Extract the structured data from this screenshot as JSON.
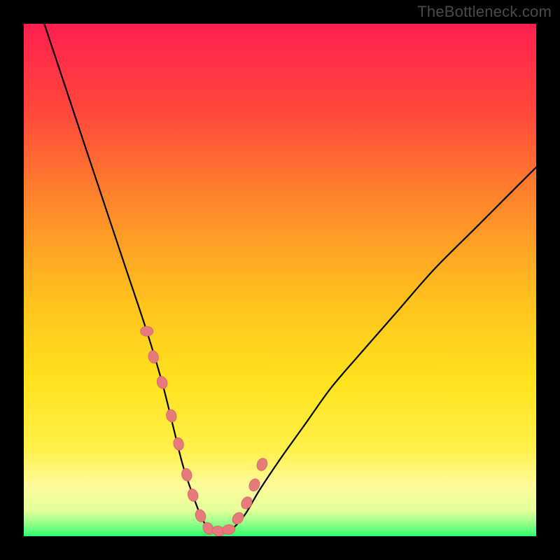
{
  "watermark": "TheBottleneck.com",
  "colors": {
    "frame": "#000000",
    "curve": "#000000",
    "dots_fill": "#e77a7a",
    "dots_stroke": "#d66a6a",
    "gradient_stops": [
      {
        "offset": 0.0,
        "color": "#ff1f4f"
      },
      {
        "offset": 0.18,
        "color": "#ff4a3a"
      },
      {
        "offset": 0.36,
        "color": "#ff8b2a"
      },
      {
        "offset": 0.54,
        "color": "#ffc21e"
      },
      {
        "offset": 0.7,
        "color": "#ffe31e"
      },
      {
        "offset": 0.83,
        "color": "#fff04a"
      },
      {
        "offset": 0.9,
        "color": "#fffa9a"
      },
      {
        "offset": 0.95,
        "color": "#e4ff9a"
      },
      {
        "offset": 0.975,
        "color": "#95ff8a"
      },
      {
        "offset": 1.0,
        "color": "#2bff6a"
      }
    ]
  },
  "chart_data": {
    "type": "line",
    "title": "",
    "xlabel": "",
    "ylabel": "",
    "xlim": [
      0,
      100
    ],
    "ylim": [
      0,
      100
    ],
    "grid": false,
    "series": [
      {
        "name": "bottleneck-curve",
        "x": [
          4,
          8,
          12,
          16,
          20,
          24,
          27,
          29,
          31,
          33,
          35,
          37,
          40,
          43,
          46,
          50,
          55,
          60,
          66,
          73,
          80,
          88,
          96,
          100
        ],
        "y": [
          100,
          88,
          76,
          64,
          52,
          40,
          30,
          22,
          14,
          8,
          3,
          1,
          1,
          4,
          9,
          15,
          22,
          29,
          36,
          44,
          52,
          60,
          68,
          72
        ]
      }
    ],
    "markers": {
      "name": "emphasis-dots",
      "x": [
        24.0,
        25.3,
        27.0,
        28.8,
        30.2,
        31.8,
        33.0,
        34.5,
        36.0,
        38.0,
        40.0,
        41.8,
        43.5,
        45.0,
        46.5
      ],
      "y": [
        40.0,
        35.0,
        30.0,
        23.5,
        18.0,
        12.0,
        8.0,
        4.0,
        1.5,
        1.0,
        1.3,
        3.5,
        6.5,
        10.0,
        14.0
      ]
    }
  }
}
